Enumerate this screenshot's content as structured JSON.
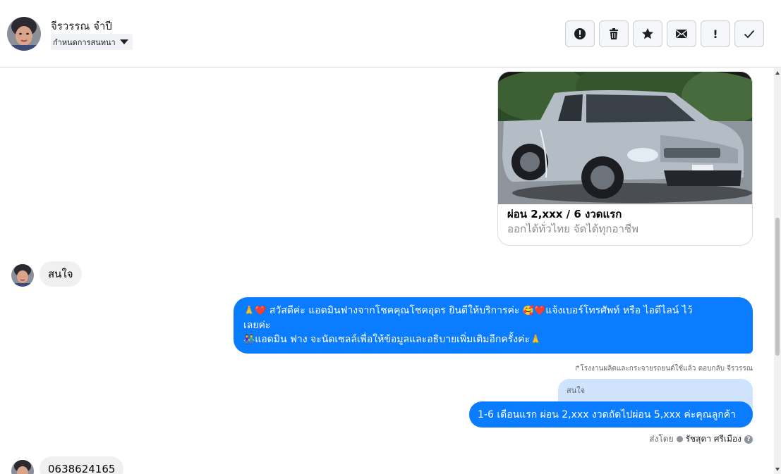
{
  "header": {
    "contact_name": "จีรวรรณ จำปี",
    "label_button": "กำหนดการสนทนา",
    "actions": [
      {
        "icon": "alert-circle-icon",
        "name": "spam-button"
      },
      {
        "icon": "trash-icon",
        "name": "delete-button"
      },
      {
        "icon": "star-icon",
        "name": "star-button"
      },
      {
        "icon": "envelope-icon",
        "name": "mark-unread-button"
      },
      {
        "icon": "exclamation-icon",
        "name": "follow-up-button",
        "text": "!"
      },
      {
        "icon": "check-icon",
        "name": "done-button"
      }
    ]
  },
  "thread": {
    "card": {
      "title": "ผ่อน 2,xxx / 6 งวดแรก",
      "subtitle": "ออกได้ทั่วไทย จัดได้ทุกอาชีพ"
    },
    "incoming_1": "สนใจ",
    "outgoing_multi": {
      "line1_emoji_a": "🙏❤️",
      "line1_text_a": " สวัสดีค่ะ แอดมินฟางจากโชคคุณโชคอุดร ยินดีให้บริการค่ะ ",
      "line1_emoji_b": "🥰❤️",
      "line1_text_b": "แจ้งเบอร์โทรศัพท์ หรือ ไอดีไลน์  ไว้",
      "line2": "เลยค่ะ",
      "line3_emoji_a": "👫",
      "line3_text": "แอดมิน ฟาง จะนัดเซลล์เพื่อให้ข้อมูลและอธิบายเพิ่มเติมอีกครั้งค่ะ",
      "line3_emoji_b": "🙏"
    },
    "reply_note": "↱โรงงานผลิตและกระจายรถยนต์ใช้แล้ว ตอบกลับ จีรวรรณ",
    "quoted_text": "สนใจ",
    "outgoing_single": "1-6 เดือนแรก ผ่อน 2,xxx งวดถัดไปผ่อน 5,xxx ค่ะคุณลูกค้า",
    "sent_by_label": "ส่งโดย",
    "sent_by_name": "รัชสุดา ศรีเมือง",
    "help_mark": "?",
    "incoming_2": "0638624165"
  },
  "colors": {
    "outgoing_bubble": "#0a7cff",
    "incoming_bubble": "#f0f0f0",
    "quoted_bubble": "#cfe3fd"
  }
}
